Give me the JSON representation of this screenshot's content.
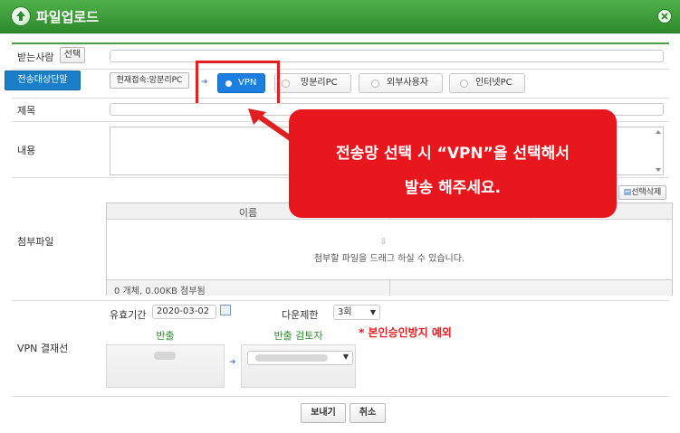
{
  "window": {
    "title": "파일업로드"
  },
  "recipient": {
    "label": "받는사람",
    "select_label": "선택"
  },
  "network": {
    "target_button": "전송대상단말",
    "current_connection": "현재접속:망분리PC",
    "options": [
      {
        "label": "VPN",
        "selected": true
      },
      {
        "label": "망분리PC",
        "selected": false
      },
      {
        "label": "외부사용자",
        "selected": false
      },
      {
        "label": "인터넷PC",
        "selected": false
      }
    ]
  },
  "subject": {
    "label": "제목"
  },
  "content": {
    "label": "내용"
  },
  "callout": {
    "line1": "전송망 선택 시 “VPN”을 선택해서",
    "line2": "발송 해주세요."
  },
  "attachments": {
    "label": "첨부파일",
    "delete_button": "선택삭제",
    "column_name": "이름",
    "drop_hint": "첨부할 파일을 드래그 하실 수 있습니다.",
    "summary": "0 개체, 0.00KB 첨부됨"
  },
  "approval": {
    "label": "VPN 결재선",
    "validity_label": "유효기간",
    "validity_date": "2020-03-02",
    "download_limit_label": "다운제한",
    "download_limit_value": "3회",
    "note": "* 본인승인방지 예외",
    "col_export": "반출",
    "col_reviewer": "반출 검토자"
  },
  "footer": {
    "send_button": "보내기",
    "cancel_button": "취소"
  },
  "colors": {
    "title_green": "#3c9e39",
    "accent_blue": "#1a7fe0",
    "callout_red": "#e8171d"
  }
}
